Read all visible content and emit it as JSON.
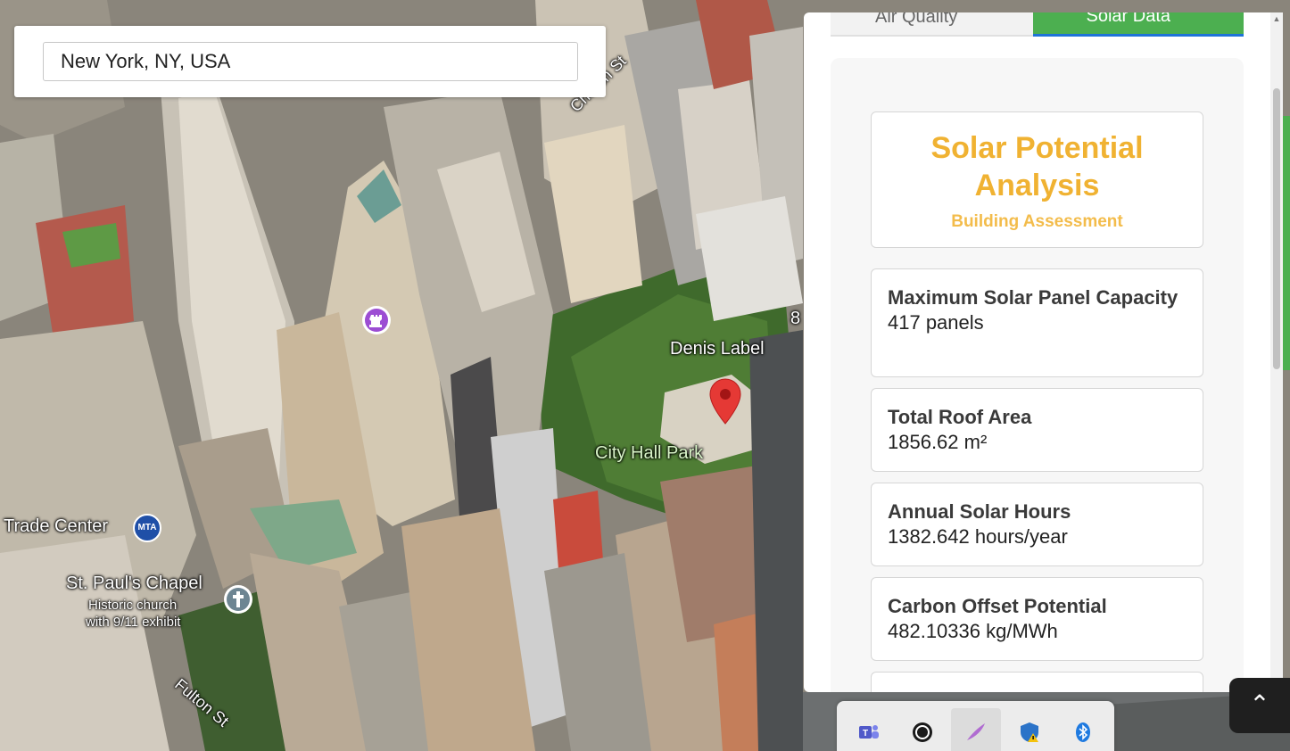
{
  "search": {
    "value": "New York, NY, USA"
  },
  "map": {
    "labels": {
      "church_st": "Church St",
      "denis_label": "Denis Label",
      "city_hall_park": "City Hall Park",
      "trade_center": "Trade Center",
      "st_pauls": "St. Paul's Chapel",
      "st_pauls_desc_1": "Historic church",
      "st_pauls_desc_2": "with 9/11 exhibit",
      "fulton_st": "Fulton St",
      "mta": "MTA",
      "edge_number": "8"
    }
  },
  "tabs": [
    {
      "label": "Air Quality"
    },
    {
      "label": "Solar Data"
    }
  ],
  "panel": {
    "title": "Solar Potential Analysis",
    "subtitle": "Building Assessment",
    "stats": [
      {
        "label": "Maximum Solar Panel Capacity",
        "value": "417 panels"
      },
      {
        "label": "Total Roof Area",
        "value": "1856.62 m²"
      },
      {
        "label": "Annual Solar Hours",
        "value": "1382.642 hours/year"
      },
      {
        "label": "Carbon Offset Potential",
        "value": "482.10336 kg/MWh"
      }
    ]
  },
  "colors": {
    "accent_title": "#f0b232",
    "tab_active": "#4caf50",
    "map_pin": "#e53935"
  },
  "tray_icons": [
    "teams-icon",
    "obs-icon",
    "pen-icon",
    "defender-icon",
    "bluetooth-icon"
  ]
}
